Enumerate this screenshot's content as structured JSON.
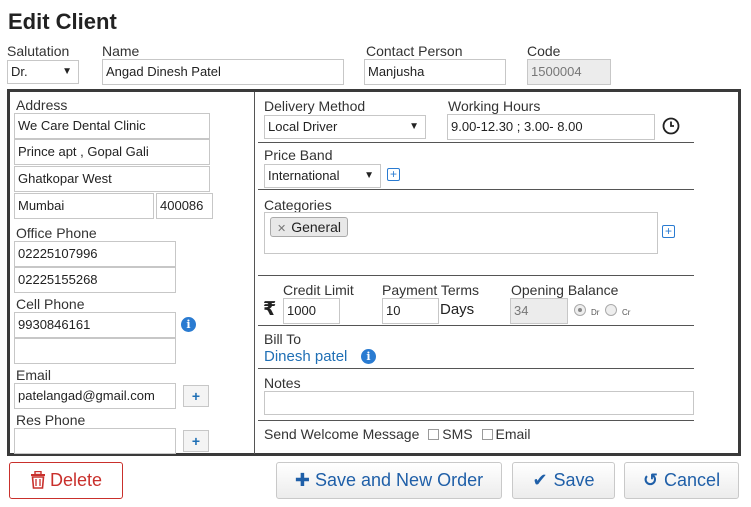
{
  "title": "Edit Client",
  "top": {
    "salutation_label": "Salutation",
    "salutation_value": "Dr.",
    "name_label": "Name",
    "name_value": "Angad Dinesh Patel",
    "contact_label": "Contact Person",
    "contact_value": "Manjusha",
    "code_label": "Code",
    "code_value": "1500004"
  },
  "left": {
    "address_label": "Address",
    "address_line1": "We Care Dental Clinic",
    "address_line2": "Prince apt , Gopal Gali",
    "address_line3": "Ghatkopar West",
    "city": "Mumbai",
    "pincode": "400086",
    "office_phone_label": "Office Phone",
    "office_phone1": "02225107996",
    "office_phone2": "02225155268",
    "cell_phone_label": "Cell Phone",
    "cell_phone1": "9930846161",
    "cell_phone2": "",
    "email_label": "Email",
    "email_value": "patelangad@gmail.com",
    "res_phone_label": "Res Phone",
    "res_phone_value": "",
    "plus": "+"
  },
  "right": {
    "delivery_label": "Delivery Method",
    "delivery_value": "Local Driver",
    "working_hours_label": "Working Hours",
    "working_hours_value": "9.00-12.30 ; 3.00- 8.00",
    "price_band_label": "Price Band",
    "price_band_value": "International",
    "categories_label": "Categories",
    "category_tag": "General",
    "rupee": "₹",
    "credit_limit_label": "Credit Limit",
    "credit_limit_value": "1000",
    "payment_terms_label": "Payment Terms",
    "payment_terms_value": "10",
    "days_label": "Days",
    "opening_balance_label": "Opening Balance",
    "opening_balance_value": "34",
    "dr_label": "Dr",
    "cr_label": "Cr",
    "bill_to_label": "Bill To",
    "bill_to_value": "Dinesh patel",
    "notes_label": "Notes",
    "notes_value": "",
    "welcome_label": "Send Welcome Message",
    "sms_label": "SMS",
    "email_opt_label": "Email"
  },
  "buttons": {
    "delete": "Delete",
    "save_new_order": "Save and New Order",
    "save": "Save",
    "cancel": "Cancel"
  }
}
